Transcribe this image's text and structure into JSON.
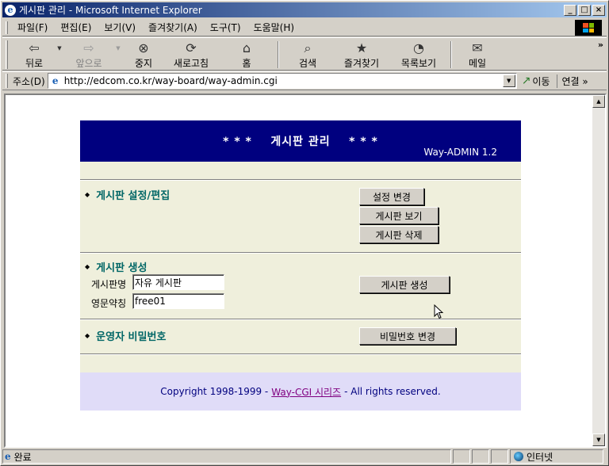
{
  "window": {
    "title": "게시판 관리 - Microsoft Internet Explorer",
    "minimize": "_",
    "maximize": "□",
    "close": "×"
  },
  "menu": [
    "파일(F)",
    "편집(E)",
    "보기(V)",
    "즐겨찾기(A)",
    "도구(T)",
    "도움말(H)"
  ],
  "toolbar": {
    "back": "뒤로",
    "forward": "앞으로",
    "stop": "중지",
    "refresh": "새로고침",
    "home": "홈",
    "search": "검색",
    "favorites": "즐겨찾기",
    "history": "목록보기",
    "mail": "메일",
    "more": "»"
  },
  "address": {
    "label": "주소(D)",
    "url": "http://edcom.co.kr/way-board/way-admin.cgi",
    "go": "이동",
    "links": "연결 »"
  },
  "page": {
    "title": "* * *    게시판 관리    * * *",
    "version": "Way-ADMIN 1.2",
    "sections": {
      "settings": {
        "title": "게시판 설정/편집",
        "btn_change": "설정 변경",
        "btn_view": "게시판 보기",
        "btn_delete": "게시판 삭제"
      },
      "create": {
        "title": "게시판 생성",
        "name_label": "게시판명",
        "name_value": "자유 게시판",
        "abbr_label": "영문약칭",
        "abbr_value": "free01",
        "btn_create": "게시판 생성"
      },
      "password": {
        "title": "운영자 비밀번호",
        "btn_change": "비밀번호 변경"
      }
    },
    "footer": {
      "prefix": "Copyright 1998-1999  -",
      "link": "Way-CGI 시리즈",
      "suffix": "-   All rights reserved."
    }
  },
  "status": {
    "text": "완료",
    "zone": "인터넷"
  }
}
